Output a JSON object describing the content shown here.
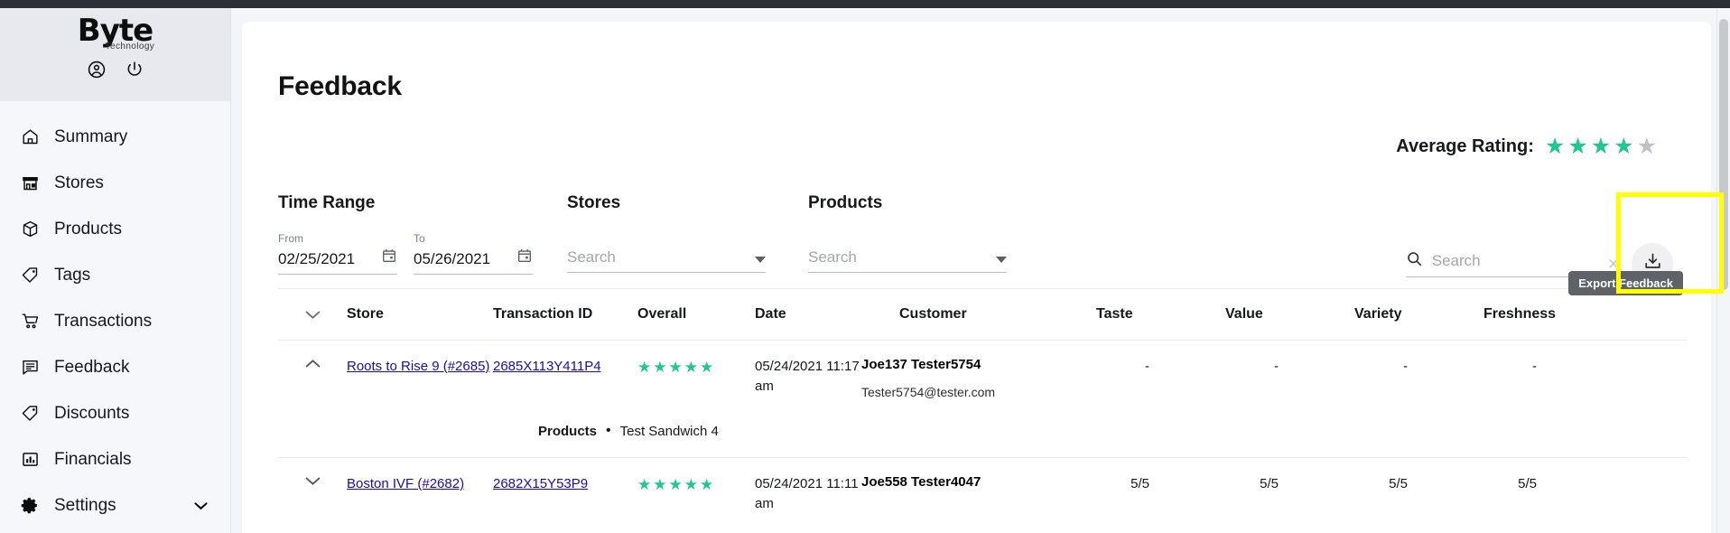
{
  "sidebar": {
    "logo": {
      "brand": "Byte",
      "sub": "Technology"
    },
    "header_icons": [
      {
        "name": "account-circle-icon",
        "label": "Account"
      },
      {
        "name": "power-icon",
        "label": "Log out"
      }
    ],
    "items": [
      {
        "label": "Summary",
        "icon": "home-icon"
      },
      {
        "label": "Stores",
        "icon": "store-icon"
      },
      {
        "label": "Products",
        "icon": "box-icon"
      },
      {
        "label": "Tags",
        "icon": "tag-icon"
      },
      {
        "label": "Transactions",
        "icon": "cart-icon"
      },
      {
        "label": "Feedback",
        "icon": "comment-icon"
      },
      {
        "label": "Discounts",
        "icon": "tag-icon"
      },
      {
        "label": "Financials",
        "icon": "bar-chart-icon"
      },
      {
        "label": "Settings",
        "icon": "gear-icon",
        "chevron": "⌄"
      }
    ]
  },
  "page": {
    "title": "Feedback"
  },
  "average_rating": {
    "label": "Average Rating:",
    "filled": 4,
    "total": 5,
    "filled_color": "#1fc98e",
    "empty_color": "#bfc1c6",
    "star_glyph": "★"
  },
  "filters": {
    "time_range": {
      "title": "Time Range",
      "from": {
        "label": "From",
        "value": "02/25/2021"
      },
      "to": {
        "label": "To",
        "value": "05/26/2021"
      }
    },
    "stores": {
      "title": "Stores",
      "placeholder": "Search",
      "value": ""
    },
    "products": {
      "title": "Products",
      "placeholder": "Search",
      "value": ""
    }
  },
  "search": {
    "placeholder": "Search",
    "value": "",
    "clear_glyph": "×"
  },
  "export": {
    "tooltip": "Export Feedback",
    "icon": "download-icon"
  },
  "highlight": {
    "color": "#ffff00"
  },
  "table": {
    "columns": [
      "",
      "Store",
      "Transaction ID",
      "Overall",
      "Date",
      "Customer",
      "Taste",
      "Value",
      "Variety",
      "Freshness"
    ],
    "rows": [
      {
        "expanded": true,
        "chevron": "⌃",
        "store": "Roots to Rise 9 (#2685)",
        "transaction_id": "2685X113Y411P4",
        "overall_stars": 5,
        "date": "05/24/2021 11:17 am",
        "customer_name": "Joe137 Tester5754",
        "customer_email": "Tester5754@tester.com",
        "taste": "-",
        "value": "-",
        "variety": "-",
        "freshness": "-",
        "products_label": "Products",
        "products": "Test Sandwich 4"
      },
      {
        "expanded": false,
        "chevron": "⌄",
        "store": "Boston IVF (#2682)",
        "transaction_id": "2682X15Y53P9",
        "overall_stars": 5,
        "date": "05/24/2021 11:11 am",
        "customer_name": "Joe558 Tester4047",
        "customer_email": "",
        "taste": "5/5",
        "value": "5/5",
        "variety": "5/5",
        "freshness": "5/5",
        "products_label": "",
        "products": ""
      }
    ]
  }
}
